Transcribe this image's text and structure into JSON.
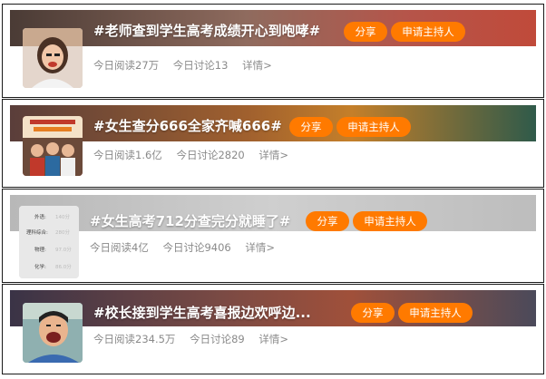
{
  "cards": [
    {
      "title": "#老师查到学生高考成绩开心到咆哮#",
      "share_label": "分享",
      "host_label": "申请主持人",
      "reads": "今日阅读27万",
      "discussions": "今日讨论13",
      "detail": "详情>",
      "banner_colors": [
        "#4a3b35",
        "#8f6b5e",
        "#c04a3a"
      ]
    },
    {
      "title": "#女生查分666全家齐喊666#",
      "share_label": "分享",
      "host_label": "申请主持人",
      "reads": "今日阅读1.6亿",
      "discussions": "今日讨论2820",
      "detail": "详情>",
      "banner_colors": [
        "#5a3e3a",
        "#c47f2a",
        "#2f5a4a"
      ],
      "thumb_text": [
        "高考有我喜讯",
        "全家齐喊666"
      ]
    },
    {
      "title": "#女生高考712分查完分就睡了#",
      "share_label": "分享",
      "host_label": "申请主持人",
      "reads": "今日阅读4亿",
      "discussions": "今日讨论9406",
      "detail": "详情>",
      "banner_colors": [
        "#b8b8b8",
        "#cfcfcf",
        "#bdbdbd"
      ],
      "thumb_rows": [
        {
          "label": "外语:",
          "value": "140分"
        },
        {
          "label": "理科综合:",
          "value": "280分"
        },
        {
          "label": "物理:",
          "value": "97.0分"
        },
        {
          "label": "化学:",
          "value": "86.0分"
        }
      ]
    },
    {
      "title": "#校长接到学生高考喜报边欢呼边...",
      "share_label": "分享",
      "host_label": "申请主持人",
      "reads": "今日阅读234.5万",
      "discussions": "今日讨论89",
      "detail": "详情>",
      "banner_colors": [
        "#3a3346",
        "#a0503a",
        "#4b4a5a"
      ]
    }
  ],
  "accent_color": "#ff7a00"
}
